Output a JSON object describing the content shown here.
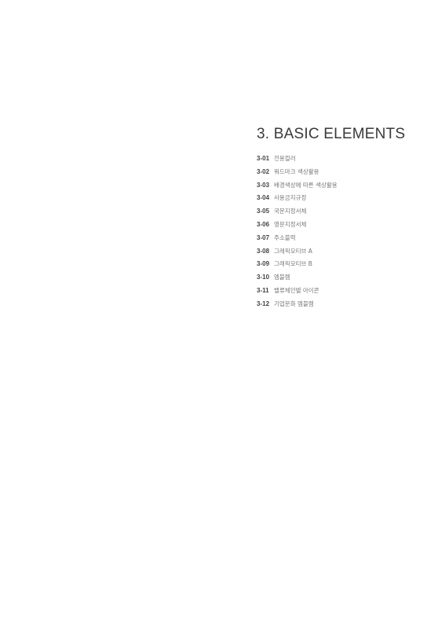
{
  "section": {
    "title": "3. BASIC ELEMENTS",
    "items": [
      {
        "num": "3-01",
        "label": "전용컬러"
      },
      {
        "num": "3-02",
        "label": "워드마크 색상활용"
      },
      {
        "num": "3-03",
        "label": "배경색상에 따른 색상활용"
      },
      {
        "num": "3-04",
        "label": "사용금지규정"
      },
      {
        "num": "3-05",
        "label": "국문지정서체"
      },
      {
        "num": "3-06",
        "label": "영문지정서체"
      },
      {
        "num": "3-07",
        "label": "주소블럭"
      },
      {
        "num": "3-08",
        "label": "그래픽모티브 A"
      },
      {
        "num": "3-09",
        "label": "그래픽모티브 B"
      },
      {
        "num": "3-10",
        "label": "엠블렘"
      },
      {
        "num": "3-11",
        "label": "밸류체인별 아이콘"
      },
      {
        "num": "3-12",
        "label": "기업문화 엠블렘"
      }
    ]
  }
}
